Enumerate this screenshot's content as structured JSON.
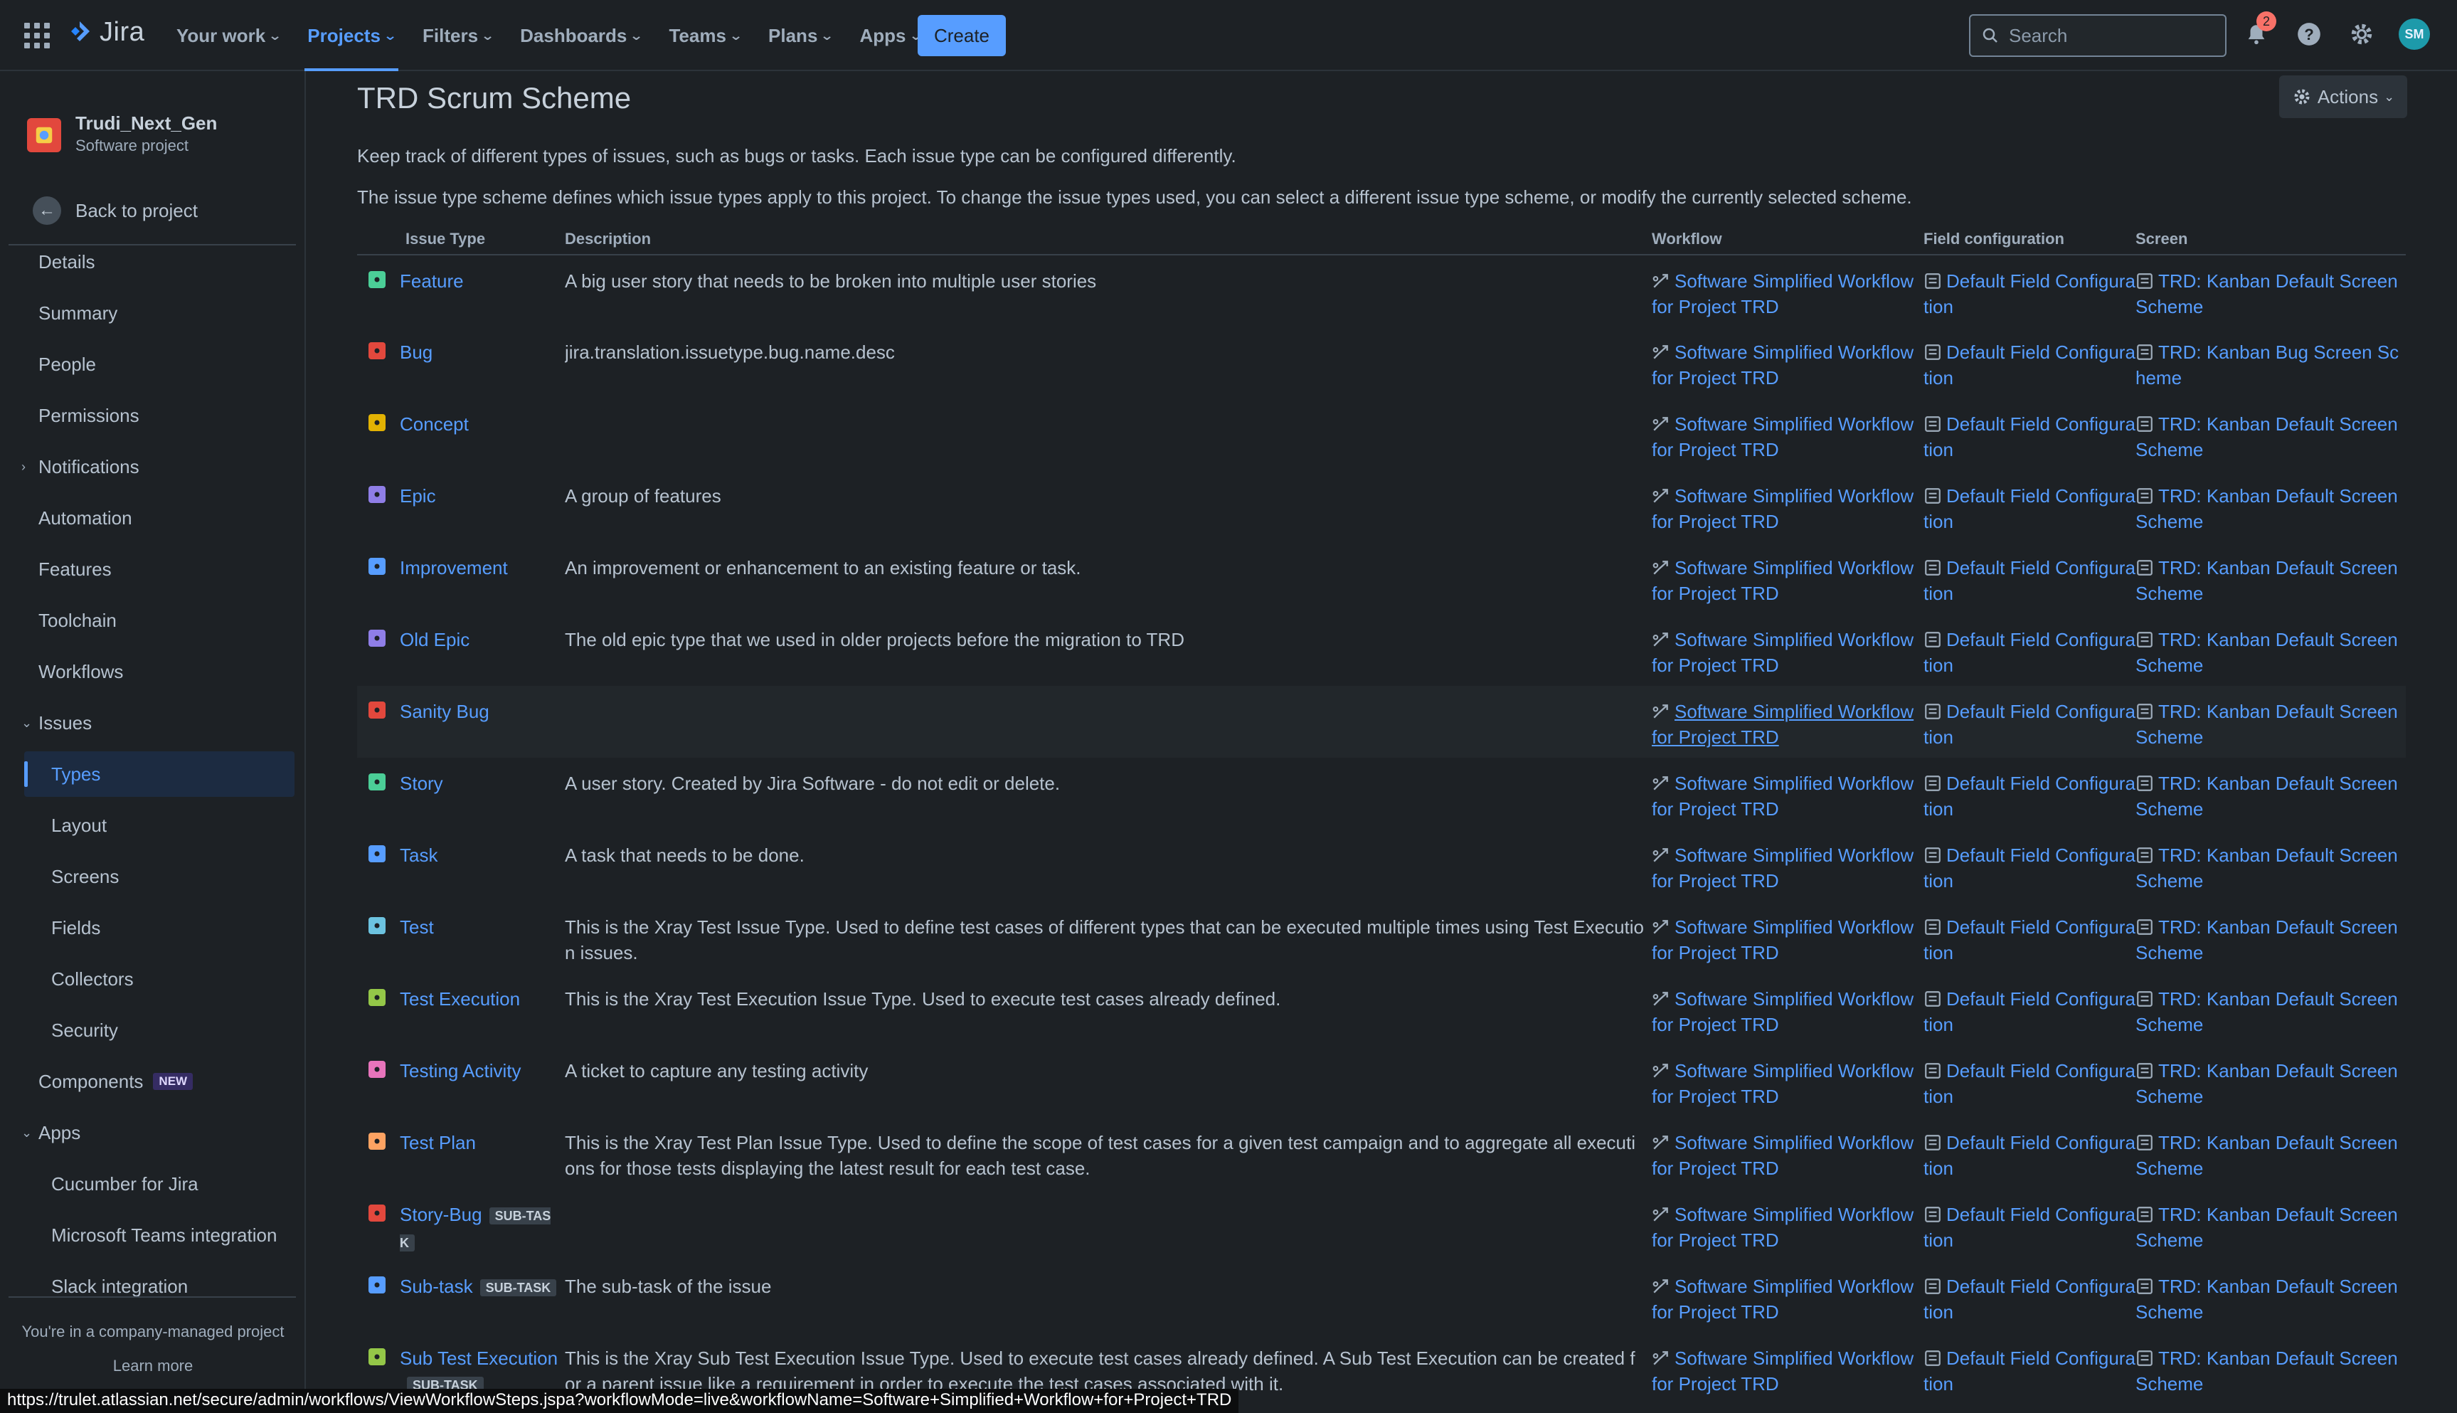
{
  "topnav": {
    "logo_text": "Jira",
    "items": [
      {
        "label": "Your work",
        "active": false
      },
      {
        "label": "Projects",
        "active": true
      },
      {
        "label": "Filters",
        "active": false
      },
      {
        "label": "Dashboards",
        "active": false
      },
      {
        "label": "Teams",
        "active": false
      },
      {
        "label": "Plans",
        "active": false
      },
      {
        "label": "Apps",
        "active": false
      }
    ],
    "create_label": "Create",
    "search_placeholder": "Search",
    "notification_count": "2",
    "avatar_initials": "SM",
    "icons": [
      "app-switcher-icon",
      "jira-logo-icon",
      "search-icon",
      "bell-icon",
      "help-icon",
      "gear-icon"
    ]
  },
  "sidebar": {
    "project_name": "Trudi_Next_Gen",
    "project_type": "Software project",
    "back_label": "Back to project",
    "items": [
      {
        "label": "Details"
      },
      {
        "label": "Summary"
      },
      {
        "label": "People"
      },
      {
        "label": "Permissions"
      },
      {
        "label": "Notifications"
      },
      {
        "label": "Automation"
      },
      {
        "label": "Features"
      },
      {
        "label": "Toolchain"
      },
      {
        "label": "Workflows"
      },
      {
        "label": "Issues"
      },
      {
        "label": "Types"
      },
      {
        "label": "Layout"
      },
      {
        "label": "Screens"
      },
      {
        "label": "Fields"
      },
      {
        "label": "Collectors"
      },
      {
        "label": "Security"
      },
      {
        "label": "Components"
      },
      {
        "label": "Apps"
      },
      {
        "label": "Cucumber for Jira"
      },
      {
        "label": "Microsoft Teams integration"
      },
      {
        "label": "Slack integration"
      }
    ],
    "new_badge": "NEW",
    "footer_line1": "You're in a company-managed project",
    "footer_line2": "Learn more"
  },
  "main": {
    "title": "TRD Scrum Scheme",
    "actions_label": "Actions",
    "intro1": "Keep track of different types of issues, such as bugs or tasks. Each issue type can be configured differently.",
    "intro2": "The issue type scheme defines which issue types apply to this project. To change the issue types used, you can select a different issue type scheme, or modify the currently selected scheme.",
    "columns": [
      "Issue Type",
      "Description",
      "Workflow",
      "Field configuration",
      "Screen"
    ],
    "subtask_label": "SUB-TASK",
    "workflow_text": "Software Simplified Workflow for Project TRD",
    "field_config_text": "Default Field Configuration",
    "rows": [
      {
        "name": "Feature",
        "desc": "A big user story that needs to be broken into multiple user stories",
        "screen": "TRD: Kanban Default Screen Scheme",
        "color": "#4bce97",
        "icon": "feature-icon",
        "subtask": false
      },
      {
        "name": "Bug",
        "desc": "jira.translation.issuetype.bug.name.desc",
        "screen": "TRD: Kanban Bug Screen Scheme",
        "color": "#e2483d",
        "icon": "bug-icon",
        "subtask": false
      },
      {
        "name": "Concept",
        "desc": "",
        "screen": "TRD: Kanban Default Screen Scheme",
        "color": "#e2b203",
        "icon": "concept-icon",
        "subtask": false
      },
      {
        "name": "Epic",
        "desc": "A group of features",
        "screen": "TRD: Kanban Default Screen Scheme",
        "color": "#8f7ee7",
        "icon": "epic-icon",
        "subtask": false
      },
      {
        "name": "Improvement",
        "desc": "An improvement or enhancement to an existing feature or task.",
        "screen": "TRD: Kanban Default Screen Scheme",
        "color": "#579dff",
        "icon": "improvement-icon",
        "subtask": false
      },
      {
        "name": "Old Epic",
        "desc": "The old epic type that we used in older projects before the migration to TRD",
        "screen": "TRD: Kanban Default Screen Scheme",
        "color": "#8f7ee7",
        "icon": "old-epic-icon",
        "subtask": false
      },
      {
        "name": "Sanity Bug",
        "desc": "",
        "screen": "TRD: Kanban Default Screen Scheme",
        "color": "#e2483d",
        "icon": "sanity-bug-icon",
        "subtask": false
      },
      {
        "name": "Story",
        "desc": "A user story. Created by Jira Software - do not edit or delete.",
        "screen": "TRD: Kanban Default Screen Scheme",
        "color": "#4bce97",
        "icon": "story-icon",
        "subtask": false
      },
      {
        "name": "Task",
        "desc": "A task that needs to be done.",
        "screen": "TRD: Kanban Default Screen Scheme",
        "color": "#579dff",
        "icon": "task-icon",
        "subtask": false
      },
      {
        "name": "Test",
        "desc": "This is the Xray Test Issue Type. Used to define test cases of different types that can be executed multiple times using Test Execution issues.",
        "screen": "TRD: Kanban Default Screen Scheme",
        "color": "#6cc3e0",
        "icon": "test-icon",
        "subtask": false
      },
      {
        "name": "Test Execution",
        "desc": "This is the Xray Test Execution Issue Type. Used to execute test cases already defined.",
        "screen": "TRD: Kanban Default Screen Scheme",
        "color": "#94c748",
        "icon": "test-execution-icon",
        "subtask": false
      },
      {
        "name": "Testing Activity",
        "desc": "A ticket to capture any testing activity",
        "screen": "TRD: Kanban Default Screen Scheme",
        "color": "#e774bb",
        "icon": "testing-activity-icon",
        "subtask": false
      },
      {
        "name": "Test Plan",
        "desc": "This is the Xray Test Plan Issue Type. Used to define the scope of test cases for a given test campaign and to aggregate all executions for those tests displaying the latest result for each test case.",
        "screen": "TRD: Kanban Default Screen Scheme",
        "color": "#fea362",
        "icon": "test-plan-icon",
        "subtask": false
      },
      {
        "name": "Story-Bug",
        "desc": "",
        "screen": "TRD: Kanban Default Screen Scheme",
        "color": "#e2483d",
        "icon": "story-bug-icon",
        "subtask": true
      },
      {
        "name": "Sub-task",
        "desc": "The sub-task of the issue",
        "screen": "TRD: Kanban Default Screen Scheme",
        "color": "#579dff",
        "icon": "subtask-icon",
        "subtask": true
      },
      {
        "name": "Sub Test Execution",
        "desc": "This is the Xray Sub Test Execution Issue Type. Used to execute test cases already defined. A Sub Test Execution can be created for a parent issue like a requirement in order to execute the test cases associated with it.",
        "screen": "TRD: Kanban Default Screen Scheme",
        "color": "#94c748",
        "icon": "sub-test-execution-icon",
        "subtask": true
      }
    ]
  },
  "status_bar_url": "https://trulet.atlassian.net/secure/admin/workflows/ViewWorkflowSteps.jspa?workflowMode=live&workflowName=Software+Simplified+Workflow+for+Project+TRD"
}
